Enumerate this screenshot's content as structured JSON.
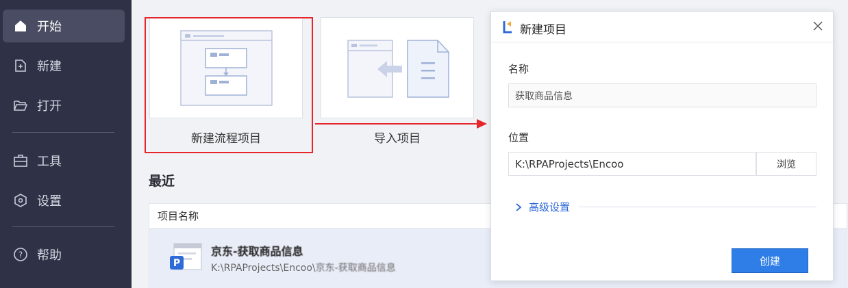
{
  "sidebar": {
    "items": [
      {
        "label": "开始",
        "icon": "home-icon"
      },
      {
        "label": "新建",
        "icon": "new-file-icon"
      },
      {
        "label": "打开",
        "icon": "folder-open-icon"
      },
      {
        "label": "工具",
        "icon": "toolbox-icon"
      },
      {
        "label": "设置",
        "icon": "settings-icon"
      },
      {
        "label": "帮助",
        "icon": "help-icon"
      }
    ]
  },
  "cards": {
    "new_flow": {
      "label": "新建流程项目"
    },
    "import": {
      "label": "导入项目"
    }
  },
  "recent": {
    "title": "最近",
    "column_header": "项目名称",
    "rows": [
      {
        "title": "京东-获取商品信息",
        "path_prefix": "K:\\RPAProjects\\Encoo\\",
        "path_suffix": "京东-获取商品信息",
        "badge": "P"
      }
    ]
  },
  "dialog": {
    "title": "新建项目",
    "name_label": "名称",
    "name_value": "获取商品信息",
    "location_label": "位置",
    "location_value": "K:\\RPAProjects\\Encoo",
    "browse_label": "浏览",
    "advanced_label": "高级设置",
    "create_label": "创建"
  },
  "colors": {
    "sidebar_bg": "#2f3247",
    "highlight": "#e6252c",
    "primary": "#2f7ee8",
    "link": "#2f6ad9"
  }
}
